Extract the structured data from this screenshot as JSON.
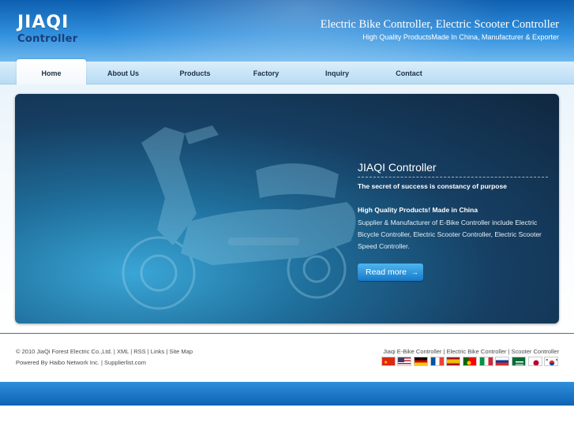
{
  "header": {
    "logo_main": "JIAQI",
    "logo_sub": "Controller",
    "title": "Electric Bike Controller, Electric Scooter Controller",
    "subtitle": "High Quality ProductsMade In China, Manufacturer & Exporter"
  },
  "nav": {
    "items": [
      {
        "label": "Home"
      },
      {
        "label": "About Us"
      },
      {
        "label": "Products"
      },
      {
        "label": "Factory"
      },
      {
        "label": "Inquiry"
      },
      {
        "label": "Contact"
      }
    ]
  },
  "banner": {
    "title": "JIAQI Controller",
    "tagline": "The secret of success is constancy of purpose",
    "heading": "High Quality Products! Made in China",
    "body": "Supplier & Manufacturer of E-Bike Controller include Electric Bicycle Controller, Electric Scooter Controller, Electric Scooter Speed Controller.",
    "button_label": "Read more",
    "button_arrow": "→",
    "image_icon": "scooter-image"
  },
  "footer": {
    "copyright": "© 2010 JiaQi Forest Electric Co.,Ltd.",
    "links": [
      "XML",
      "RSS",
      "Links",
      "Site Map"
    ],
    "powered": "Powered By Haibo Network Inc.",
    "powered_link": "Supplierlist.com",
    "right_links": [
      "Jiaqi E-Bike Controller",
      "Electric Bike Controller",
      "Scooter Controller"
    ],
    "separator": " | ",
    "flags": [
      {
        "country": "china",
        "icon": "china-flag-icon"
      },
      {
        "country": "usa",
        "icon": "usa-flag-icon"
      },
      {
        "country": "germany",
        "icon": "germany-flag-icon"
      },
      {
        "country": "france",
        "icon": "france-flag-icon"
      },
      {
        "country": "spain",
        "icon": "spain-flag-icon"
      },
      {
        "country": "portugal",
        "icon": "portugal-flag-icon"
      },
      {
        "country": "italy",
        "icon": "italy-flag-icon"
      },
      {
        "country": "russia",
        "icon": "russia-flag-icon"
      },
      {
        "country": "saudi-arabia",
        "icon": "saudi-arabia-flag-icon"
      },
      {
        "country": "japan",
        "icon": "japan-flag-icon"
      },
      {
        "country": "korea",
        "icon": "korea-flag-icon"
      }
    ]
  },
  "colors": {
    "header_top": "#0e5fb0",
    "header_bottom": "#6fb8ee",
    "nav_bg": "#c9e5f7",
    "banner_dark": "#10273f",
    "banner_light": "#3aa6d6",
    "button": "#1679c9",
    "footer_bar": "#1f79c8"
  }
}
